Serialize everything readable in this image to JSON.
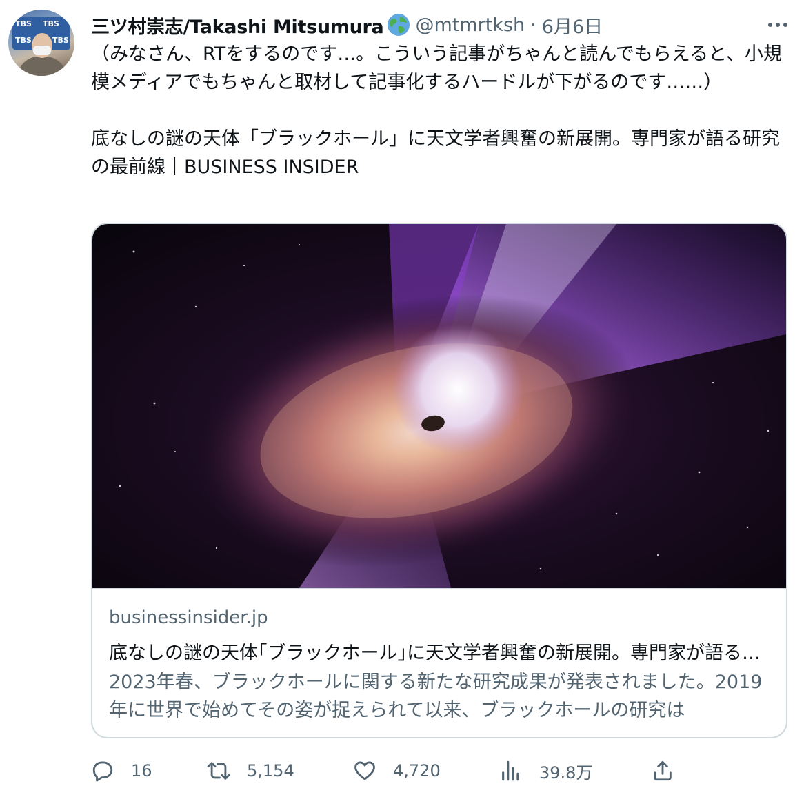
{
  "tweet": {
    "author": {
      "display_name": "三ツ村崇志/Takashi Mitsumura",
      "handle": "@mtmrtksh",
      "separator": "·",
      "date": "6月6日",
      "avatar_board_text": [
        "TBS",
        "TBS",
        "TBS",
        "TBS"
      ]
    },
    "text": "（みなさん、RTをするのです…。こういう記事がちゃんと読んでもらえると、小規模メディアでもちゃんと取材して記事化するハードルが下がるのです……）\n\n底なしの謎の天体「ブラックホール」に天文学者興奮の新展開。専門家が語る研究の最前線｜BUSINESS INSIDER",
    "card": {
      "domain": "businessinsider.jp",
      "title": "底なしの謎の天体｢ブラックホール｣に天文学者興奮の新展開。専門家が語る研究の最前線",
      "description": "2023年春、ブラックホールに関する新たな研究成果が発表されました。2019年に世界で始めてその姿が捉えられて以来、ブラックホールの研究は"
    },
    "actions": {
      "replies": "16",
      "retweets": "5,154",
      "likes": "4,720",
      "views": "39.8万"
    },
    "icons": {
      "verified_globe": "globe-icon",
      "more": "more-icon",
      "reply": "reply-icon",
      "retweet": "retweet-icon",
      "like": "like-icon",
      "views": "views-icon",
      "share": "share-icon"
    },
    "colors": {
      "text": "#0f1419",
      "secondary": "#536471",
      "border": "#cfd9de"
    }
  }
}
